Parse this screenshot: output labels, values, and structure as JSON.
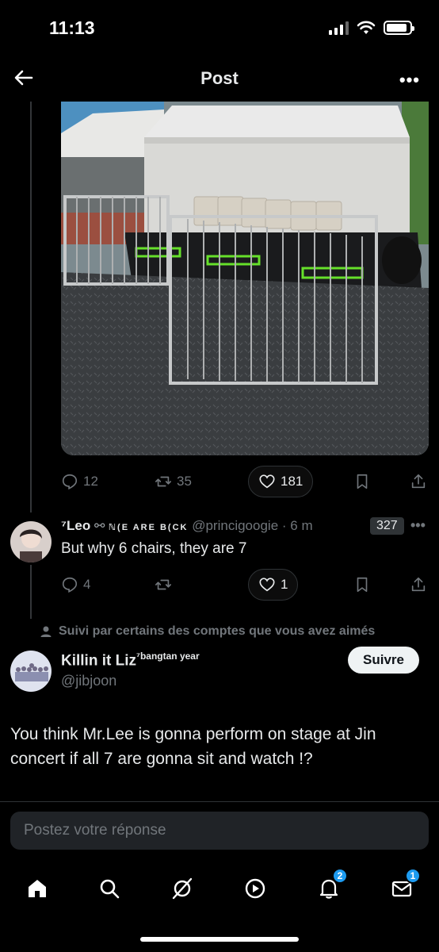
{
  "status_bar": {
    "time": "11:13"
  },
  "header": {
    "title": "Post"
  },
  "parent_post": {
    "stats": {
      "replies": "12",
      "reposts": "35",
      "likes": "181"
    }
  },
  "reply": {
    "display_name": "⁷Leo",
    "name_decoration": "ℕ(E ARE B(CK",
    "handle": "@princigoogie",
    "time": "· 6 m",
    "badge": "327",
    "text": "But why 6 chairs, they are 7",
    "stats": {
      "replies": "4",
      "likes": "1"
    }
  },
  "social_context": "Suivi par certains des comptes que vous avez aimés",
  "main_post": {
    "display_name": "Killin it Liz",
    "name_suffix": "⁷bangtan year",
    "handle": "@jibjoon",
    "follow_label": "Suivre",
    "text": "You think Mr.Lee is gonna perform on stage at Jin concert if all 7 are gonna sit and watch !?"
  },
  "reply_box": {
    "placeholder": "Postez votre réponse"
  },
  "tabbar": {
    "notifications_badge": "2",
    "messages_badge": "1"
  },
  "colors": {
    "accent": "#1d9bf0",
    "background": "#000000",
    "muted": "#71767b"
  }
}
